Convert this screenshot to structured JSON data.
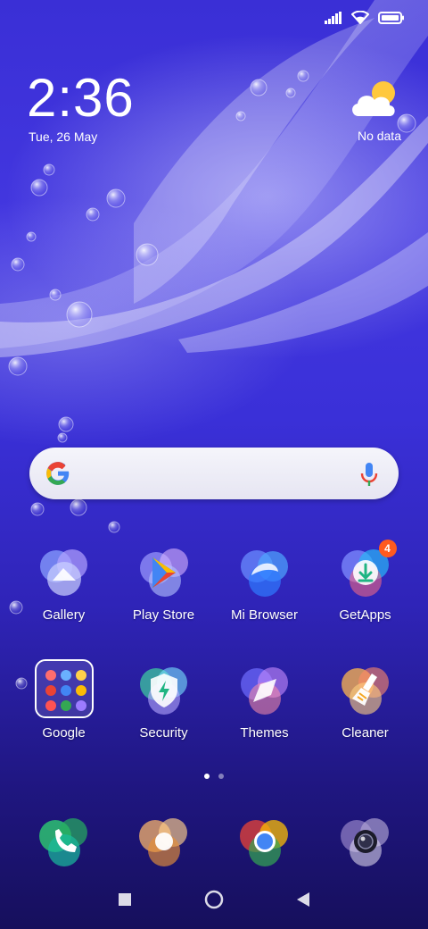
{
  "status_bar": {
    "icons": [
      "signal-icon",
      "wifi-icon",
      "battery-icon"
    ]
  },
  "clock": {
    "time": "2:36",
    "date": "Tue, 26 May"
  },
  "weather": {
    "icon": "partly-cloudy-icon",
    "text": "No data"
  },
  "search": {
    "icons": [
      "google-g-icon",
      "microphone-icon"
    ]
  },
  "home_apps": [
    {
      "label": "Gallery",
      "icon": "gallery-icon"
    },
    {
      "label": "Play Store",
      "icon": "play-store-icon"
    },
    {
      "label": "Mi Browser",
      "icon": "mi-browser-icon"
    },
    {
      "label": "GetApps",
      "icon": "getapps-icon",
      "badge": "4"
    },
    {
      "label": "Google",
      "icon": "google-folder-icon"
    },
    {
      "label": "Security",
      "icon": "security-icon"
    },
    {
      "label": "Themes",
      "icon": "themes-icon"
    },
    {
      "label": "Cleaner",
      "icon": "cleaner-icon"
    }
  ],
  "page_indicator": {
    "pages": 2,
    "current": 1
  },
  "dock": [
    {
      "icon": "phone-icon"
    },
    {
      "icon": "messaging-icon"
    },
    {
      "icon": "chrome-icon"
    },
    {
      "icon": "camera-icon"
    }
  ],
  "nav_bar": {
    "buttons": [
      "recents-button",
      "home-button",
      "back-button"
    ]
  },
  "colors": {
    "badge": "#ff5a1f",
    "accent": "#4337e0"
  }
}
